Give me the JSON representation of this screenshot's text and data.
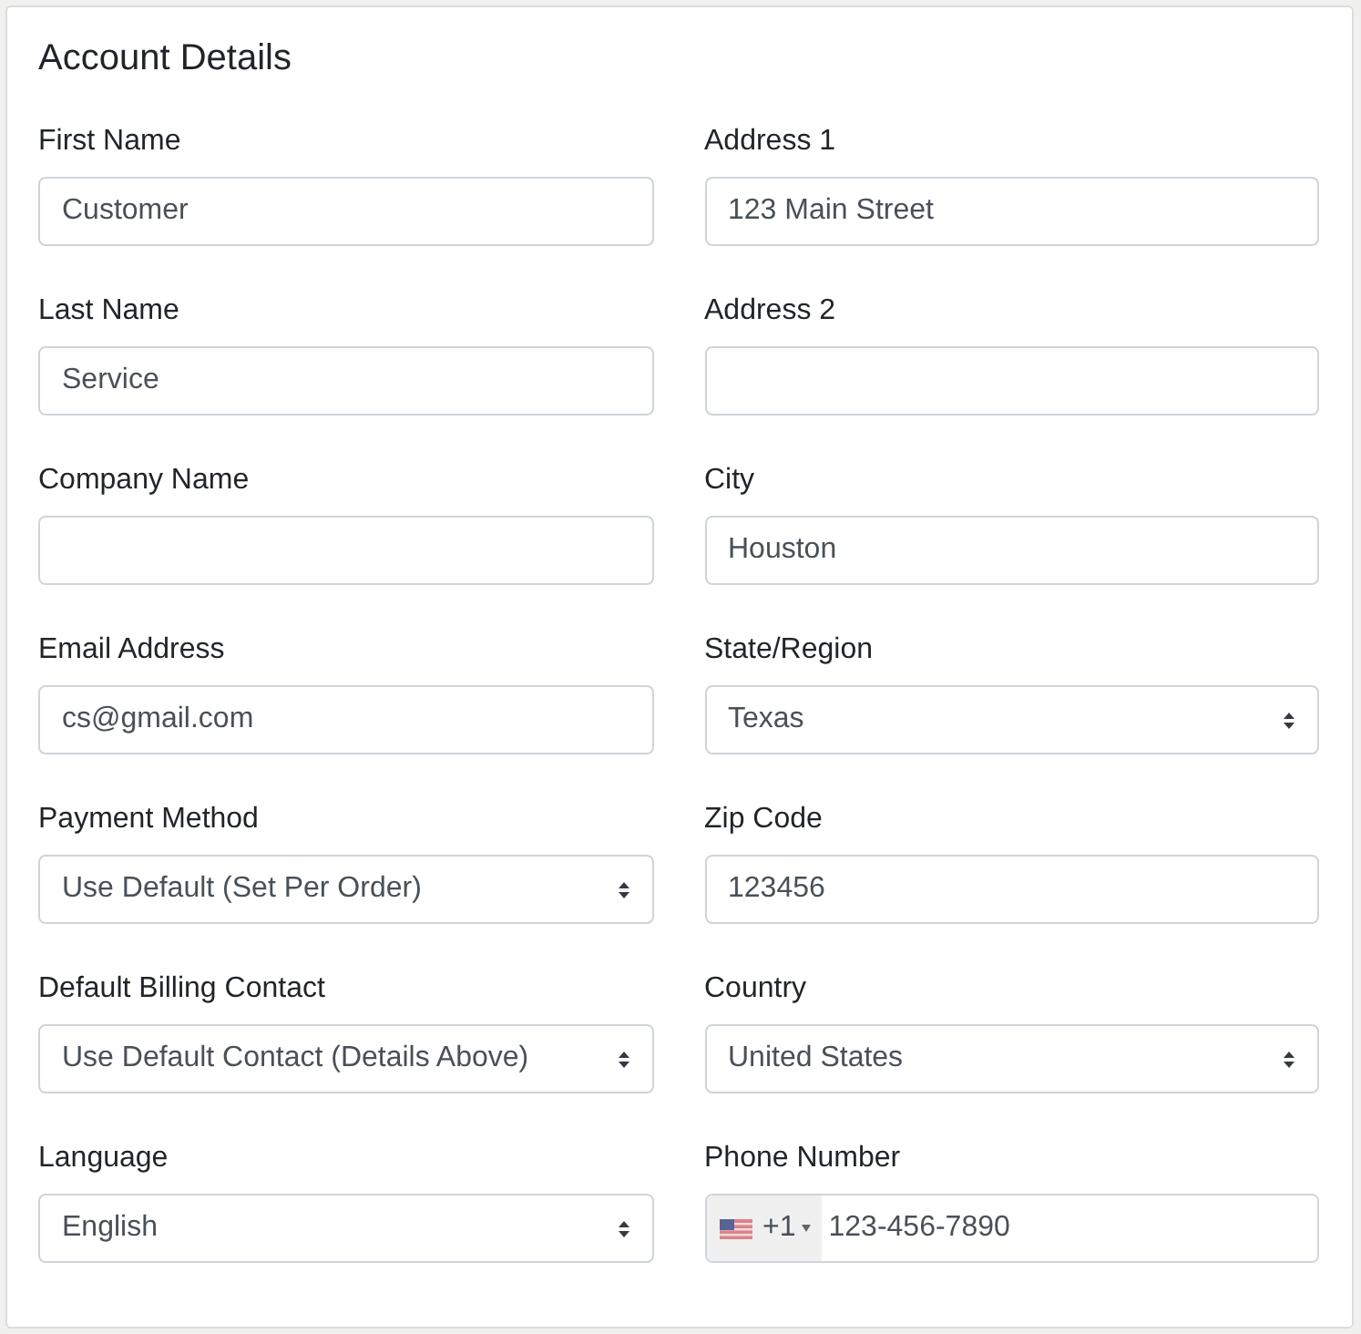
{
  "card": {
    "title": "Account Details"
  },
  "fields": [
    {
      "kind": "text",
      "label": "First Name",
      "value": "Customer"
    },
    {
      "kind": "text",
      "label": "Address 1",
      "value": "123 Main Street"
    },
    {
      "kind": "text",
      "label": "Last Name",
      "value": "Service"
    },
    {
      "kind": "text",
      "label": "Address 2"
    },
    {
      "kind": "text",
      "label": "Company Name"
    },
    {
      "kind": "text",
      "label": "City",
      "value": "Houston"
    },
    {
      "kind": "text",
      "label": "Email Address",
      "value": "cs@gmail.com"
    },
    {
      "kind": "select",
      "label": "State/Region",
      "value": "Texas"
    },
    {
      "kind": "select",
      "label": "Payment Method",
      "value": "Use Default (Set Per Order)"
    },
    {
      "kind": "text",
      "label": "Zip Code",
      "value": "123456"
    },
    {
      "kind": "select",
      "label": "Default Billing Contact",
      "value": "Use Default Contact (Details Above)"
    },
    {
      "kind": "select",
      "label": "Country",
      "value": "United States"
    },
    {
      "kind": "select",
      "label": "Language",
      "value": "English"
    },
    {
      "kind": "phone",
      "label": "Phone Number",
      "dial_code": "+1",
      "value": "123-456-7890"
    }
  ]
}
